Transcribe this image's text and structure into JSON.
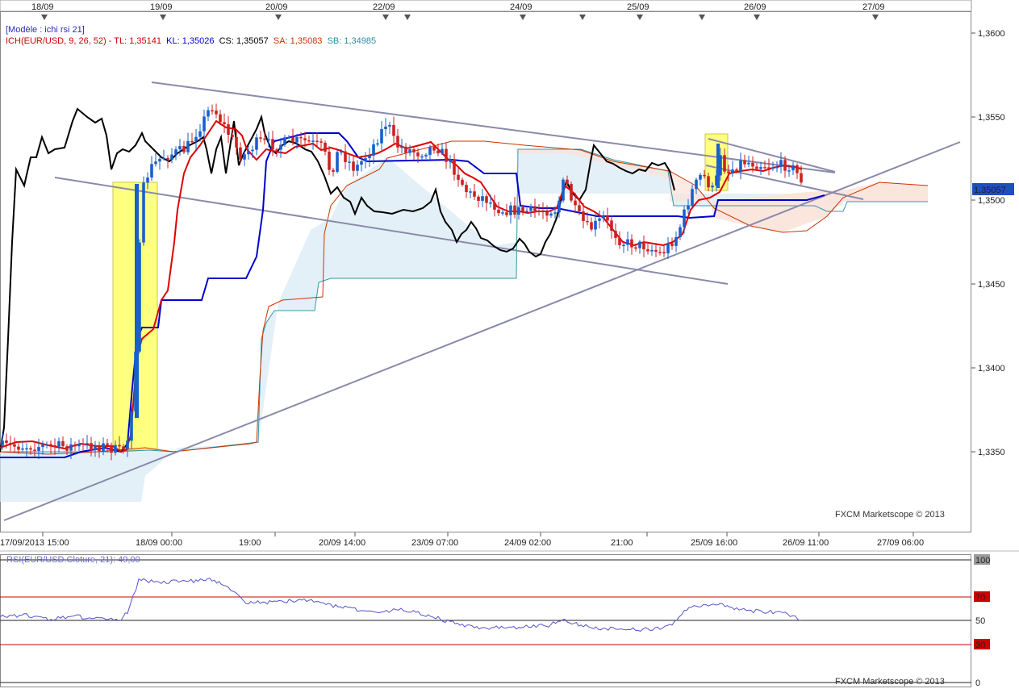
{
  "legend": {
    "model": "[Modèle : ichi rsi 21]",
    "ich_prefix": "ICH(EUR/USD, 9, 26, 52) -",
    "tl": "TL: 1,35141",
    "kl": "KL: 1,35026",
    "cs": "CS: 1,35057",
    "sa": "SA: 1,35083",
    "sb": "SB: 1,34985"
  },
  "rsi_legend": "RSI(EUR/USD.Cloture, 21): 49,00",
  "watermark_main": "FXCM Marketscope © 2013",
  "watermark_rsi": "FXCM Marketscope © 2013",
  "last_price": "1,35057",
  "colors": {
    "tenkan": "#dd0000",
    "kijun": "#0000cc",
    "chikou": "#000000",
    "span_a": "#cc3300",
    "span_b": "#3399aa",
    "bull": "#1a5fcc",
    "bear": "#cc2222",
    "trendline": "#8a8aaa",
    "highlight": "#ffff80",
    "rsi": "#5555cc"
  },
  "chart_data": [
    {
      "type": "candlestick",
      "instrument": "EUR/USD",
      "top_dates": [
        "18/09",
        "19/09",
        "20/09",
        "22/09",
        "24/09",
        "25/09",
        "26/09",
        "27/09"
      ],
      "x_tick_labels": [
        "17/09/2013 15:00",
        "18/09 00:00",
        "19:00",
        "20/09 14:00",
        "23/09 07:00",
        "24/09 02:00",
        "21:00",
        "25/09 16:00",
        "26/09 11:00",
        "27/09 06:00"
      ],
      "y_tick_labels": [
        "1,3350",
        "1,3400",
        "1,3450",
        "1,3500",
        "1,3550",
        "1,3600"
      ],
      "ylim": [
        1.33,
        1.362
      ],
      "last_value": 1.35057,
      "indicator": "ICH(EUR/USD, 9, 26, 52)",
      "series": [
        {
          "name": "TL",
          "value": 1.35141
        },
        {
          "name": "KL",
          "value": 1.35026
        },
        {
          "name": "CS",
          "value": 1.35057
        },
        {
          "name": "SA",
          "value": 1.35083
        },
        {
          "name": "SB",
          "value": 1.34985
        }
      ]
    },
    {
      "type": "line",
      "indicator": "RSI(EUR/USD.Cloture, 21)",
      "last_value": 49.0,
      "y_tick_labels": [
        "100",
        "70",
        "50",
        "30",
        "0"
      ],
      "ylim": [
        0,
        100
      ]
    }
  ]
}
